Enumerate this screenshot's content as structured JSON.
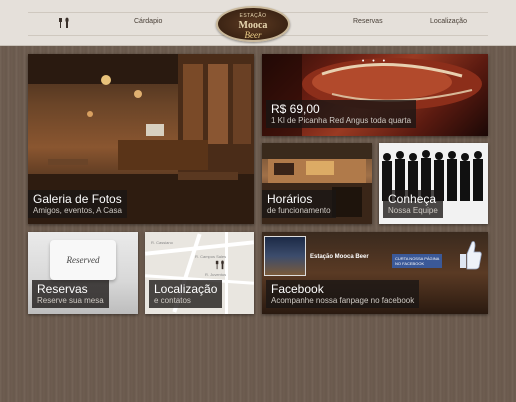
{
  "header": {
    "nav_left": "Cárdapio",
    "nav_right": [
      "Reservas",
      "Localização"
    ],
    "logo": {
      "line1": "ESTAÇÃO",
      "line2": "Mooca",
      "line3": "Beer"
    }
  },
  "tiles": {
    "galeria": {
      "title": "Galeria de Fotos",
      "subtitle": "Amigos, eventos, A Casa"
    },
    "picanha": {
      "title": "R$ 69,00",
      "subtitle": "1 Kl de Picanha Red Angus toda quarta",
      "dots": "• • •"
    },
    "horarios": {
      "title": "Horários",
      "subtitle": "de funcionamento"
    },
    "conheca": {
      "title": "Conheça",
      "subtitle": "Nossa Equipe"
    },
    "reservas": {
      "title": "Reservas",
      "subtitle": "Reserve sua mesa",
      "napkin_text": "Reserved"
    },
    "localizacao": {
      "title": "Localização",
      "subtitle": "e contatos",
      "map_labels": [
        "R. Cassiano",
        "R. Campos Sales",
        "R. Juventus"
      ]
    },
    "facebook": {
      "title": "Facebook",
      "subtitle": "Acompanhe nossa fanpage no facebook",
      "banner": "Estação Mooca Beer",
      "badge_line1": "CURTA NOSSA PÁGINA",
      "badge_line2": "NO FACEBOOK"
    }
  },
  "colors": {
    "background": "#6e5d50",
    "header_bg": "#e5e0da",
    "caption_bg": "#191614",
    "facebook_blue": "#3b5998"
  }
}
